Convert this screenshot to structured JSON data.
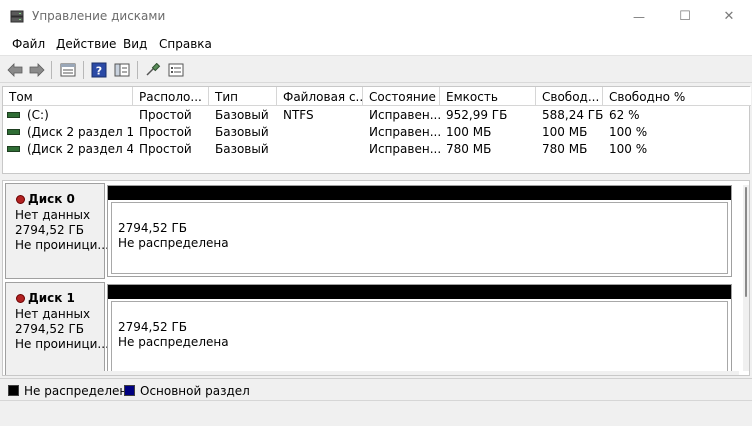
{
  "window": {
    "title": "Управление дисками",
    "minimize_glyph": "—",
    "maximize_glyph": "☐",
    "close_glyph": "✕"
  },
  "menu": [
    "Файл",
    "Действие",
    "Вид",
    "Справка"
  ],
  "toolbar": {
    "icons": [
      "back-arrow-icon",
      "forward-arrow-icon",
      "properties-icon",
      "help-icon",
      "view-icon",
      "connect-icon",
      "list-icon"
    ]
  },
  "table": {
    "columns": [
      "Том",
      "Располо...",
      "Тип",
      "Файловая с...",
      "Состояние",
      "Емкость",
      "Свобод...",
      "Свободно %"
    ],
    "rows": [
      [
        "(C:)",
        "Простой",
        "Базовый",
        "NTFS",
        "Исправен...",
        "952,99 ГБ",
        "588,24 ГБ",
        "62 %"
      ],
      [
        "(Диск 2 раздел 1)",
        "Простой",
        "Базовый",
        "",
        "Исправен...",
        "100 МБ",
        "100 МБ",
        "100 %"
      ],
      [
        "(Диск 2 раздел 4)",
        "Простой",
        "Базовый",
        "",
        "Исправен...",
        "780 МБ",
        "780 МБ",
        "100 %"
      ]
    ]
  },
  "disks": [
    {
      "name": "Диск 0",
      "status": "Нет данных",
      "size": "2794,52 ГБ",
      "init": "Не проиници...",
      "partition_size": "2794,52 ГБ",
      "partition_status": "Не распределена"
    },
    {
      "name": "Диск 1",
      "status": "Нет данных",
      "size": "2794,52 ГБ",
      "init": "Не проиници...",
      "partition_size": "2794,52 ГБ",
      "partition_status": "Не распределена"
    }
  ],
  "legend": [
    {
      "label": "Не распределена",
      "color": "#000000"
    },
    {
      "label": "Основной раздел",
      "color": "#000080"
    }
  ]
}
